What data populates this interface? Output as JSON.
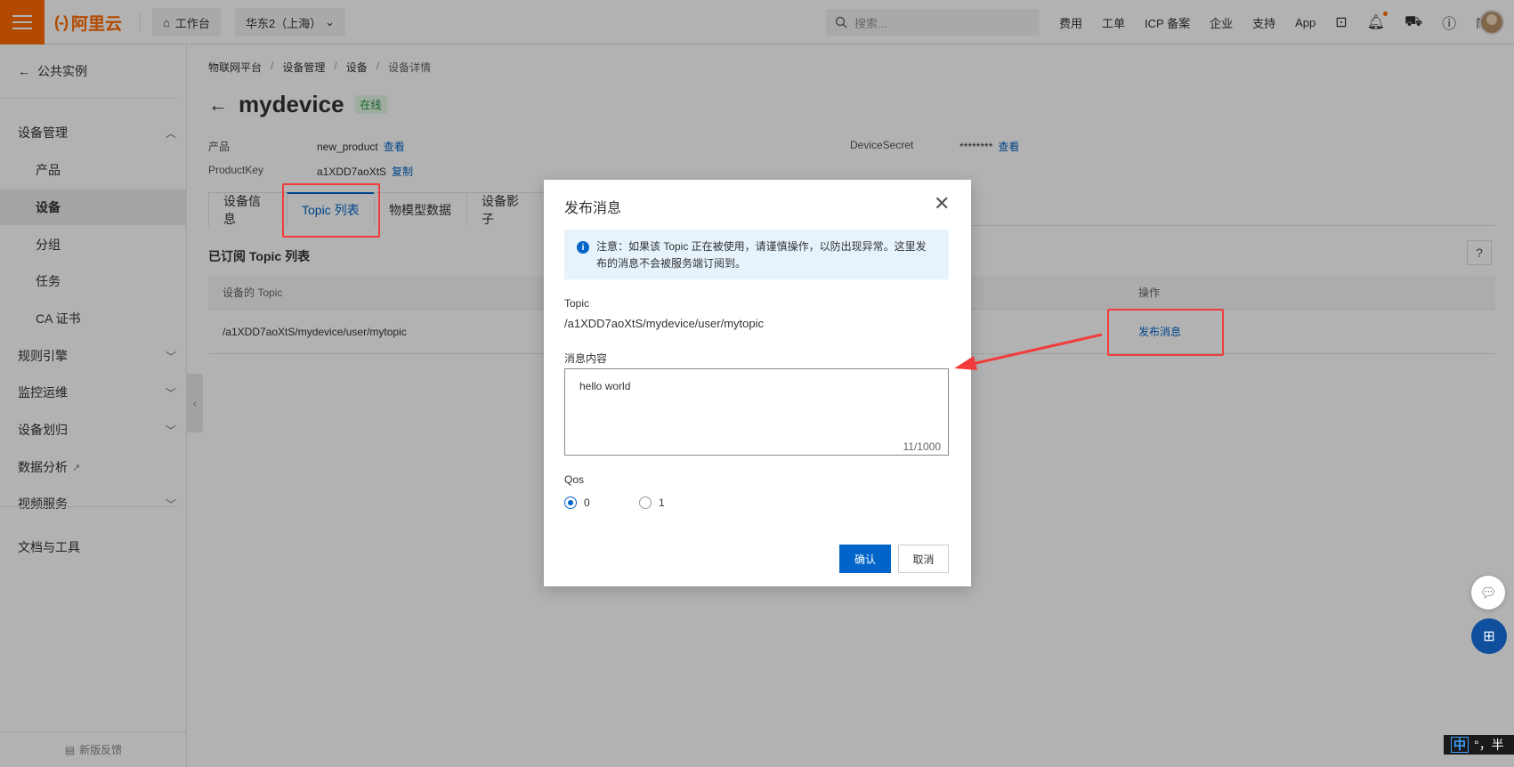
{
  "topbar": {
    "brand": "阿里云",
    "workbench": "工作台",
    "region": "华东2（上海）",
    "search_placeholder": "搜索...",
    "links": [
      "费用",
      "工单",
      "ICP 备案",
      "企业",
      "支持",
      "App"
    ],
    "lang": "简体"
  },
  "sidebar": {
    "back_label": "公共实例",
    "items": [
      {
        "label": "设备管理",
        "chevron": "up"
      },
      {
        "label": "产品"
      },
      {
        "label": "设备",
        "active": true
      },
      {
        "label": "分组"
      },
      {
        "label": "任务"
      },
      {
        "label": "CA 证书"
      },
      {
        "label": "规则引擎",
        "chevron": "down"
      },
      {
        "label": "监控运维",
        "chevron": "down"
      },
      {
        "label": "设备划归",
        "chevron": "down"
      },
      {
        "label": "数据分析"
      },
      {
        "label": "视频服务",
        "chevron": "down"
      },
      {
        "label": "文档与工具"
      }
    ],
    "footer": "新版反馈"
  },
  "breadcrumb": [
    "物联网平台",
    "设备管理",
    "设备",
    "设备详情"
  ],
  "device": {
    "name": "mydevice",
    "status": "在线",
    "product_label": "产品",
    "product_value": "new_product",
    "product_link": "查看",
    "key_label": "ProductKey",
    "key_value": "a1XDD7aoXtS",
    "key_link": "复制",
    "secret_label": "DeviceSecret",
    "secret_value": "********",
    "secret_link": "查看"
  },
  "tabs": [
    "设备信息",
    "Topic 列表",
    "物模型数据",
    "设备影子"
  ],
  "active_tab": "Topic 列表",
  "section_title": "已订阅 Topic 列表",
  "table": {
    "headers": {
      "topic": "设备的 Topic",
      "action": "操作"
    },
    "rows": [
      {
        "topic": "/a1XDD7aoXtS/mydevice/user/mytopic",
        "action": "发布消息"
      }
    ]
  },
  "modal": {
    "title": "发布消息",
    "notice": "注意：如果该 Topic 正在被使用，请谨慎操作，以防出现异常。这里发布的消息不会被服务端订阅到。",
    "topic_label": "Topic",
    "topic_value": "/a1XDD7aoXtS/mydevice/user/mytopic",
    "content_label": "消息内容",
    "content_value": "hello world",
    "counter": "11/1000",
    "qos_label": "Qos",
    "qos_options": [
      "0",
      "1"
    ],
    "qos_selected": "0",
    "confirm": "确认",
    "cancel": "取消"
  },
  "ime": {
    "mode": "中",
    "punct": "°，半"
  },
  "colors": {
    "accent": "#0064c8",
    "brand": "#ff6a00",
    "annotation": "#f23c3c"
  }
}
